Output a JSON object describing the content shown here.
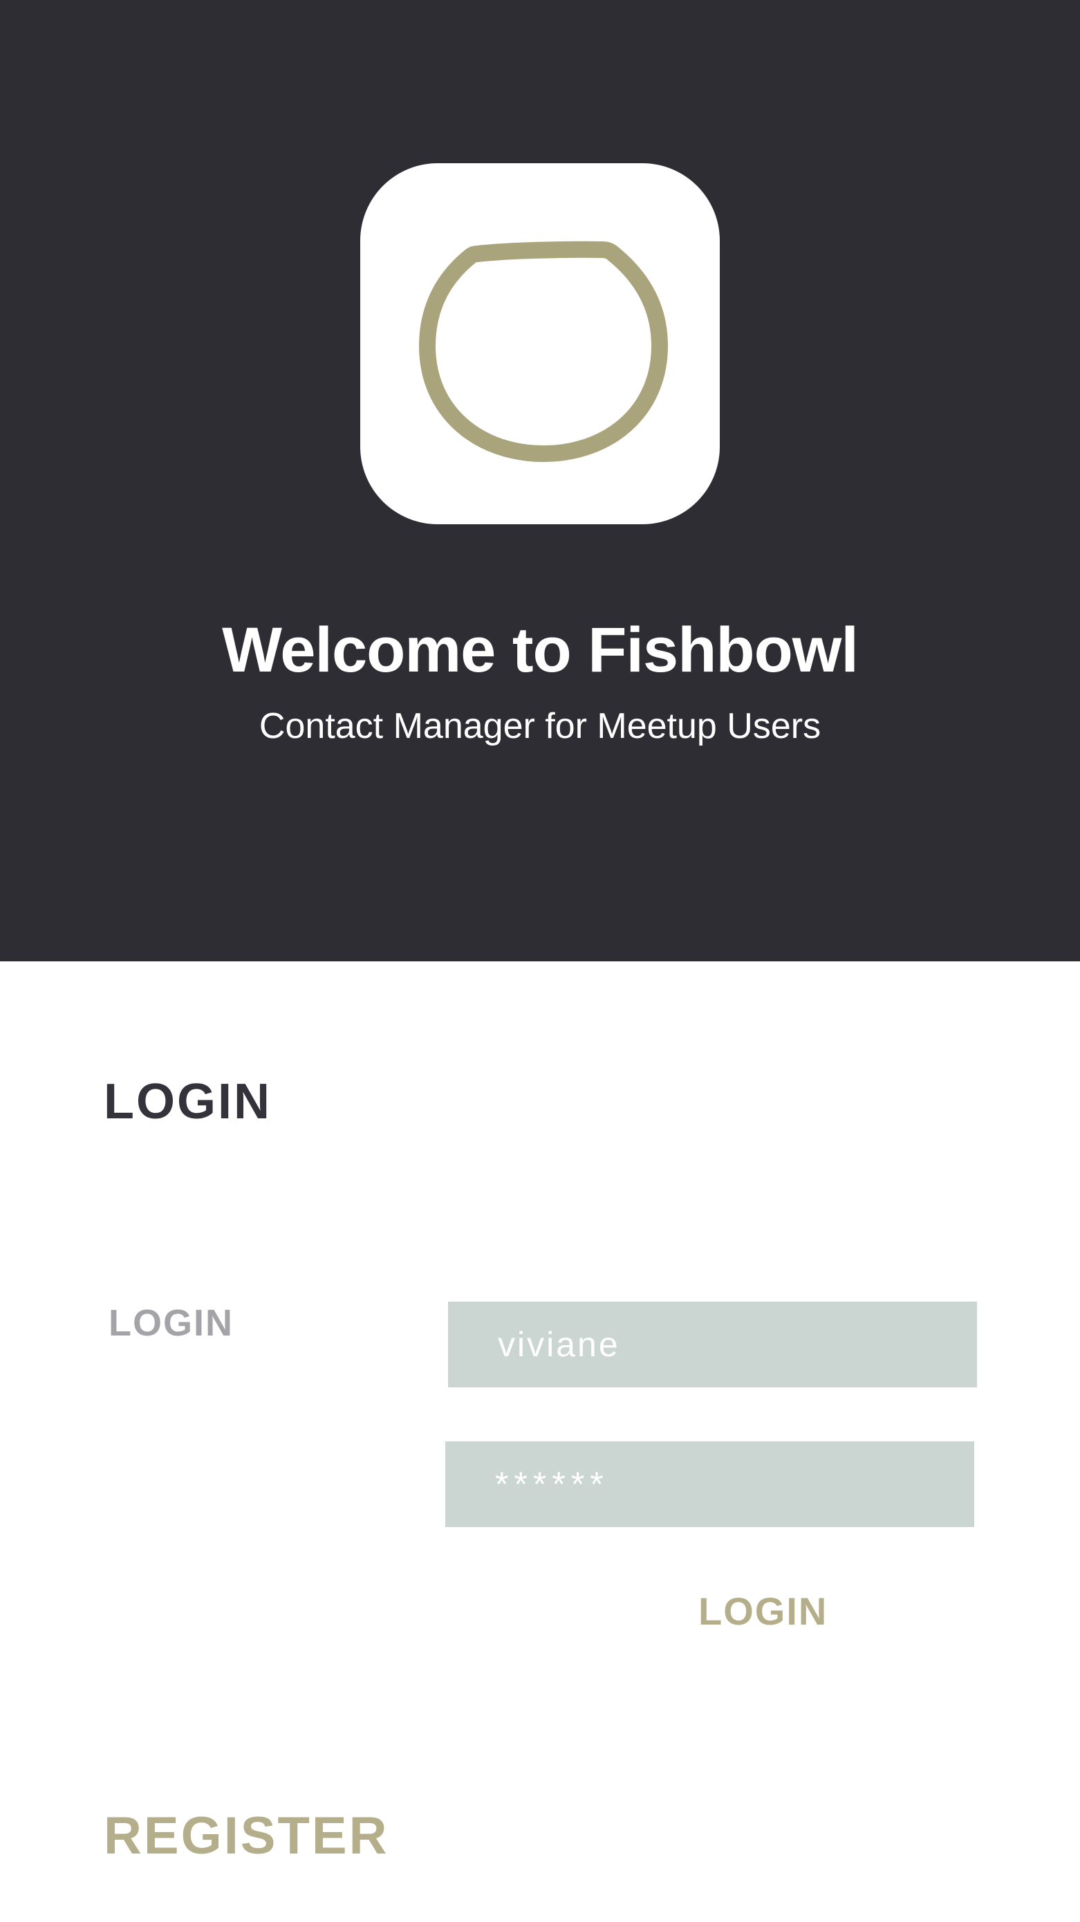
{
  "hero": {
    "title": "Welcome to Fishbowl",
    "subtitle": "Contact Manager for Meetup Users",
    "background_color": "#2e2d33",
    "logo_icon": "fishbowl-icon",
    "logo_color": "#aaa47c"
  },
  "login": {
    "section_title": "LOGIN",
    "field_label": "LOGIN",
    "username_value": "viviane",
    "password_value": "******",
    "submit_label": "LOGIN",
    "input_color": "#cbd6d3",
    "accent_color": "#b5ae8b"
  },
  "register": {
    "label": "REGISTER"
  }
}
